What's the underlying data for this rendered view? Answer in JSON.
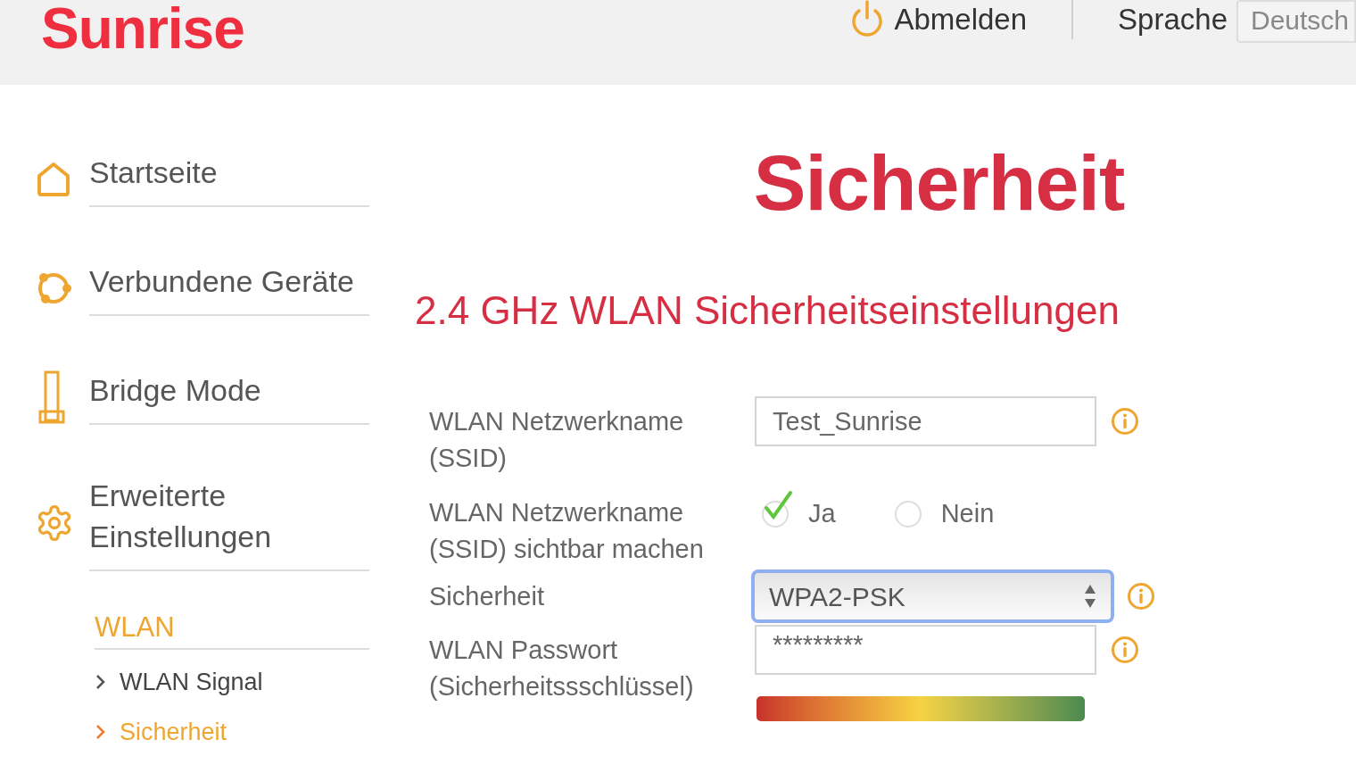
{
  "header": {
    "logo": "Sunrise",
    "logout": "Abmelden",
    "language_label": "Sprache",
    "language_value": "Deutsch"
  },
  "sidebar": {
    "items": [
      {
        "label": "Startseite"
      },
      {
        "label": "Verbundene Geräte"
      },
      {
        "label": "Bridge Mode"
      },
      {
        "label": "Erweiterte Einstellungen"
      }
    ],
    "submenu": {
      "title": "WLAN",
      "children": [
        {
          "label": "WLAN Signal",
          "selected": false
        },
        {
          "label": "Sicherheit",
          "selected": true
        }
      ]
    }
  },
  "page": {
    "title": "Sicherheit",
    "subtitle": "2.4 GHz WLAN Sicherheitseinstellungen"
  },
  "form": [
    {
      "kind": "text",
      "label": "WLAN Netzwerkname (SSID)",
      "value": "Test_Sunrise",
      "info": true
    },
    {
      "kind": "radio",
      "label": "WLAN Netzwerkname (SSID) sichtbar machen",
      "options": [
        {
          "label": "Ja",
          "selected": true
        },
        {
          "label": "Nein",
          "selected": false
        }
      ],
      "info": false
    },
    {
      "kind": "select",
      "label": "Sicherheit",
      "value": "WPA2-PSK",
      "focused": true,
      "info": true
    },
    {
      "kind": "password",
      "label": "WLAN Passwort (Sicherheitssschlüssel)",
      "value": "*********",
      "info": true
    }
  ]
}
